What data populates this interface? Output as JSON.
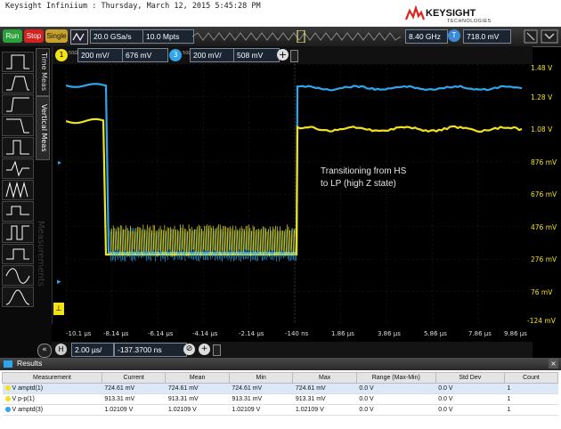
{
  "window": {
    "title": "Keysight Infiniium : Thursday, March 12, 2015 5:45:28 PM"
  },
  "brand": {
    "name": "KEYSIGHT",
    "sub": "TECHNOLOGIES"
  },
  "toolbar": {
    "run": "Run",
    "stop": "Stop",
    "single": "Single",
    "sample_rate": "20.0 GSa/s",
    "memory": "10.0 Mpts",
    "bandwidth": "8.40 GHz",
    "trigger_label": "T",
    "trigger_level": "718.0 mV"
  },
  "channels": [
    {
      "number": "1",
      "impedance": "50Ω",
      "scale": "200 mV/",
      "offset": "676 mV",
      "color": "#f2e21a"
    },
    {
      "number": "3",
      "impedance": "50Ω",
      "scale": "200 mV/",
      "offset": "508 mV",
      "color": "#2ea6ee"
    }
  ],
  "sidepanel": {
    "tab_time": "Time Meas",
    "tab_vertical": "Vertical Meas",
    "watermark": "Measurements"
  },
  "annotation": {
    "line1": "Transitioning from HS",
    "line2": "to LP (high Z state)"
  },
  "y_ticks": [
    "1.48 V",
    "1.28 V",
    "1.08 V",
    "876 mV",
    "676 mV",
    "476 mV",
    "276 mV",
    "76 mV",
    "-124 mV"
  ],
  "x_ticks": [
    "-10.1 µs",
    "-8.14 µs",
    "-6.14 µs",
    "-4.14 µs",
    "-2.14 µs",
    "-140 ns",
    "1.86 µs",
    "3.86 µs",
    "5.86 µs",
    "7.86 µs",
    "9.86 µs"
  ],
  "timebase": {
    "label": "H",
    "scale": "2.00 µs/",
    "position": "-137.3700 ns"
  },
  "results": {
    "title": "Results",
    "headers": [
      "Measurement",
      "Current",
      "Mean",
      "Min",
      "Max",
      "Range (Max-Min)",
      "Std Dev",
      "Count"
    ],
    "rows": [
      {
        "channel": "1",
        "color": "#f2e21a",
        "cells": [
          "V amptd(1)",
          "724.61 mV",
          "724.61 mV",
          "724.61 mV",
          "724.61 mV",
          "0.0 V",
          "0.0 V",
          "1"
        ]
      },
      {
        "channel": "2",
        "color": "#f2e21a",
        "cells": [
          "V p-p(1)",
          "913.31 mV",
          "913.31 mV",
          "913.31 mV",
          "913.31 mV",
          "0.0 V",
          "0.0 V",
          "1"
        ]
      },
      {
        "channel": "3",
        "color": "#2ea6ee",
        "cells": [
          "V amptd(3)",
          "1.02109 V",
          "1.02109 V",
          "1.02109 V",
          "1.02109 V",
          "0.0 V",
          "0.0 V",
          "1"
        ]
      }
    ]
  }
}
